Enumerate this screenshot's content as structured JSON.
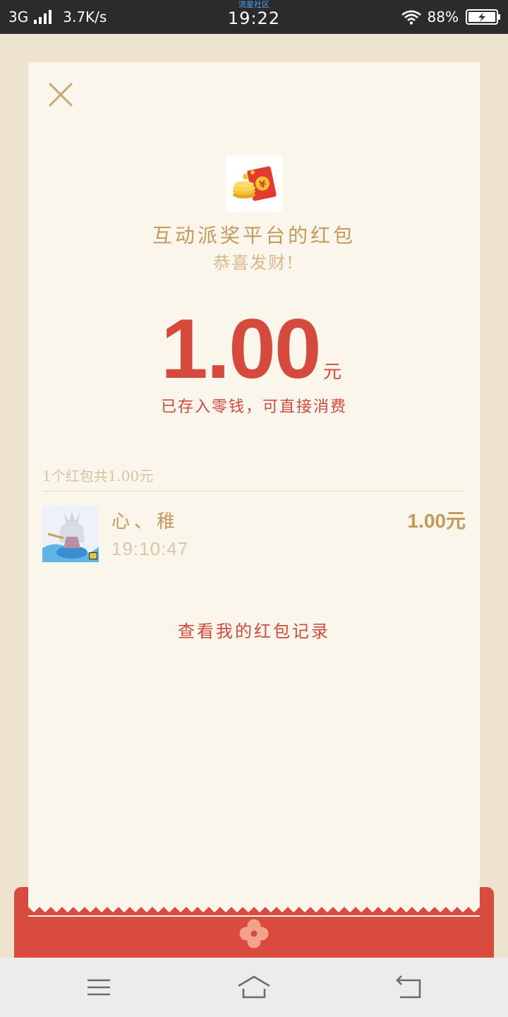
{
  "status_bar": {
    "network": "3G",
    "speed": "3.7K/s",
    "brand": "流星社区",
    "time": "19:22",
    "battery": "88%"
  },
  "red_packet": {
    "sender_title": "互动派奖平台的红包",
    "greeting": "恭喜发财!",
    "amount": "1.00",
    "unit": "元",
    "saved_note": "已存入零钱，可直接消费",
    "summary": "1个红包共1.00元"
  },
  "records": [
    {
      "name": "心、稚",
      "time": "19:10:47",
      "amount": "1.00元"
    }
  ],
  "footer": {
    "history_link": "查看我的红包记录"
  },
  "colors": {
    "accent_red": "#d64a3d",
    "gold_text": "#c49a5d",
    "card_background": "#fbf6ec",
    "page_background": "#ede3cf"
  },
  "icons": {
    "close": "close-icon",
    "logo": "red-packet-logo-icon",
    "envelope_emblem": "flower-emblem-icon",
    "nav_menu": "menu-icon",
    "nav_home": "home-icon",
    "nav_back": "back-icon"
  }
}
